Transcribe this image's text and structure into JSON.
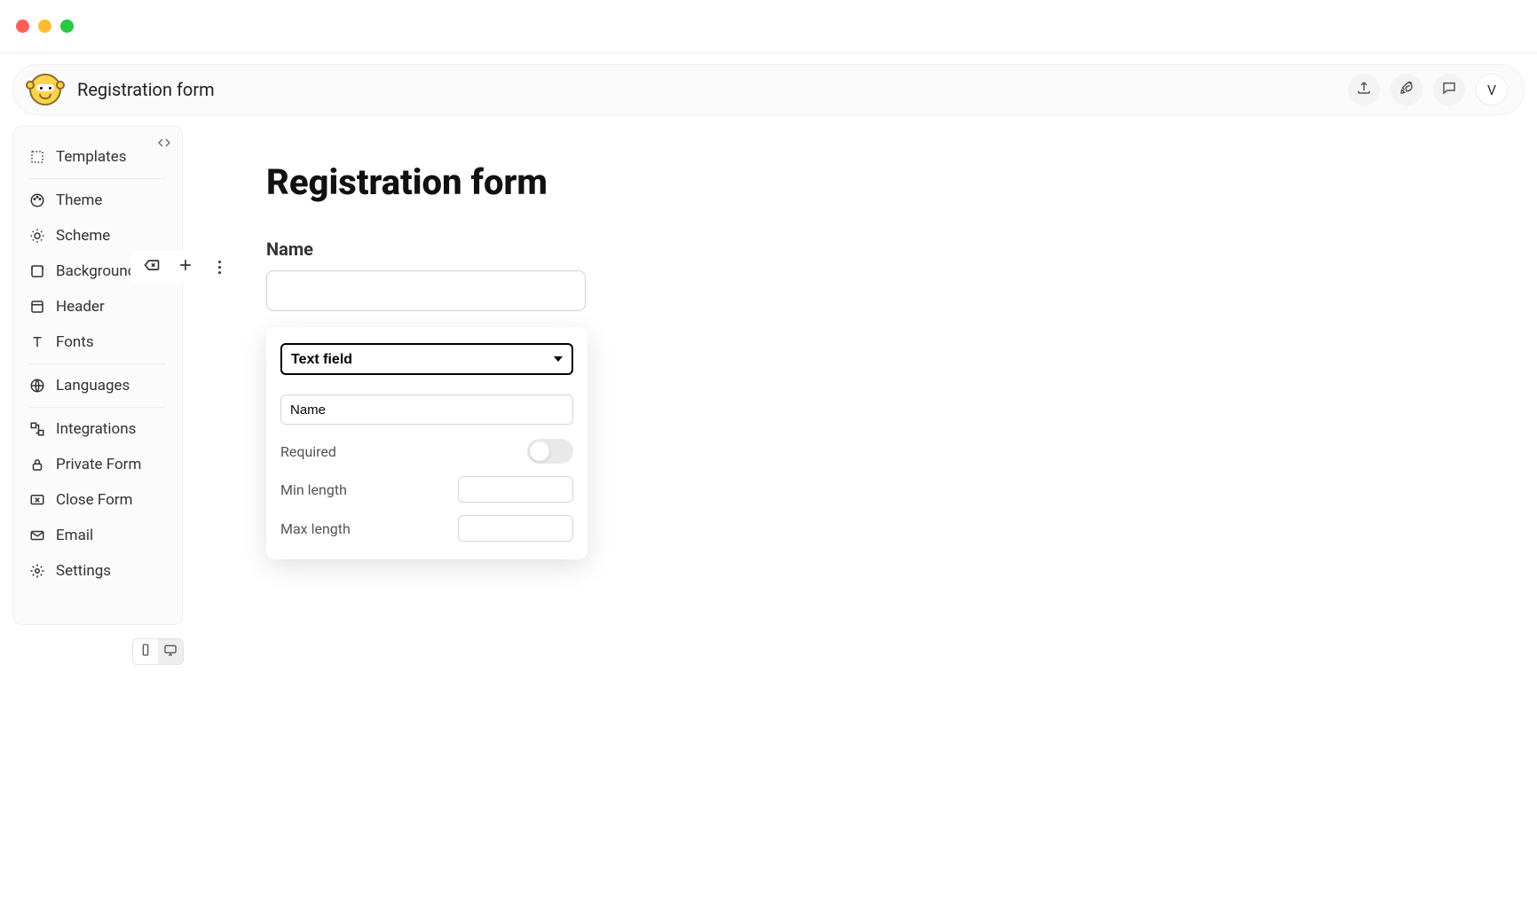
{
  "titlebar": {},
  "topbar": {
    "title": "Registration form",
    "avatar_initial": "V"
  },
  "sidebar": {
    "items": [
      {
        "label": "Templates"
      },
      {
        "label": "Theme"
      },
      {
        "label": "Scheme"
      },
      {
        "label": "Background"
      },
      {
        "label": "Header"
      },
      {
        "label": "Fonts"
      },
      {
        "label": "Languages"
      },
      {
        "label": "Integrations"
      },
      {
        "label": "Private Form"
      },
      {
        "label": "Close Form"
      },
      {
        "label": "Email"
      },
      {
        "label": "Settings"
      }
    ]
  },
  "form": {
    "title": "Registration form",
    "field_label": "Name"
  },
  "config": {
    "type_selected": "Text field",
    "label_value": "Name",
    "required_label": "Required",
    "required_on": false,
    "min_length_label": "Min length",
    "min_length_value": "",
    "max_length_label": "Max length",
    "max_length_value": ""
  }
}
